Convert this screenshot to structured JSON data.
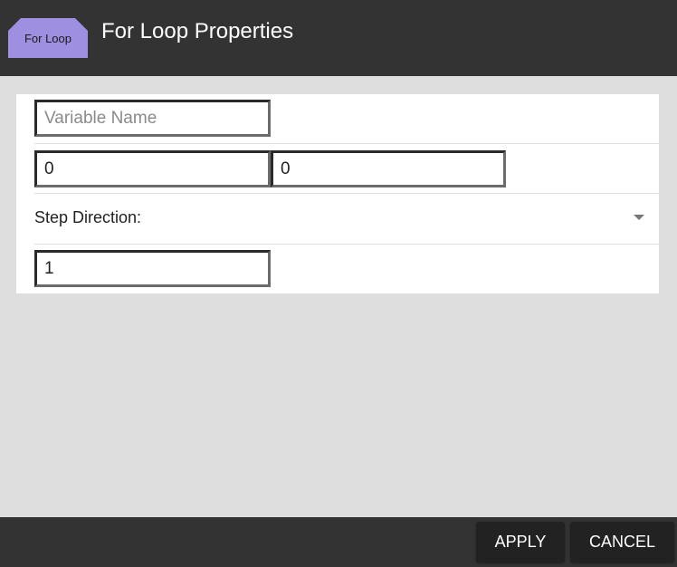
{
  "header": {
    "badge_label": "For Loop",
    "title": "For Loop Properties"
  },
  "form": {
    "variable_name": {
      "value": "",
      "placeholder": "Variable Name"
    },
    "range_start": {
      "value": "0"
    },
    "range_end": {
      "value": "0"
    },
    "step_direction": {
      "label": "Step Direction:",
      "selected": ""
    },
    "step_value": {
      "value": "1"
    }
  },
  "footer": {
    "apply_label": "APPLY",
    "cancel_label": "CANCEL"
  },
  "colors": {
    "header_bg": "#333333",
    "badge_bg": "#9e8fe0",
    "panel_bg": "#ffffff",
    "dialog_bg": "#dedede",
    "button_bg": "#222222"
  }
}
